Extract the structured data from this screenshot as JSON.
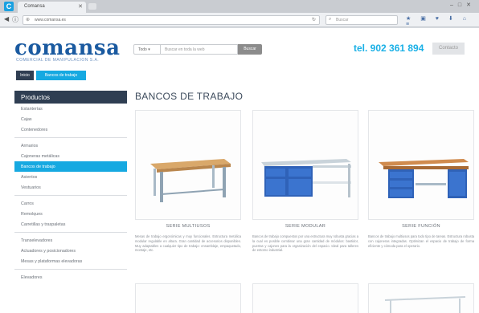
{
  "browser": {
    "tab_title": "Comansa",
    "url": "www.comansa.es",
    "search_placeholder": "Buscar"
  },
  "header": {
    "logo": "comansa",
    "logo_sub": "COMERCIAL DE MANIPULACION S.A.",
    "search_select": "Todo",
    "search_placeholder": "Buscar en toda la web",
    "search_button": "Buscar",
    "phone": "tel. 902 361 894",
    "contact_button": "Contacto"
  },
  "breadcrumb": {
    "home": "Inicio",
    "current": "Bancos de trabajo"
  },
  "sidebar": {
    "title": "Productos",
    "groups": [
      [
        "Estanterías",
        "Cajas",
        "Contenedores"
      ],
      [
        "Armarios",
        "Cajoneras metálicas",
        "Bancos de trabajo",
        "Asientos",
        "Vestuarios"
      ],
      [
        "Carros",
        "Remolques",
        "Carretillas y traspaletas"
      ],
      [
        "Transelevadores",
        "Actuadores y posicionadores",
        "Mesas y plataformas elevadoras"
      ],
      [
        "Elevadores"
      ]
    ],
    "active": "Bancos de trabajo"
  },
  "main": {
    "title": "BANCOS DE TRABAJO",
    "cards": [
      {
        "title": "SERIE MULTIUSOS",
        "desc": "Mesas de trabajo ergonómicas y muy funcionales. Estructura metálica modular regulable en altura. Gran cantidad de accesorios disponibles. Muy adaptables a cualquier tipo de trabajo: ensamblaje, empaquetado, montaje, etc."
      },
      {
        "title": "SERIE MODULAR",
        "desc": "Bancos de trabajo compuestos por una estructura muy robusta gracias a la cual es posible combinar una gran cantidad de módulos: bastidor, puertas y cajones para la organización del espacio. Ideal para talleres de entorno industrial."
      },
      {
        "title": "SERIE FUNCIÓN",
        "desc": "Bancos de trabajo multiusos para todo tipo de tareas. Estructura robusta con cajoneras integradas. Optimizan el espacio de trabajo de forma eficiente y cómoda para el operario."
      }
    ]
  },
  "colors": {
    "brand": "#1a5aa0",
    "accent": "#16a9e1",
    "dark": "#2f3e52"
  }
}
